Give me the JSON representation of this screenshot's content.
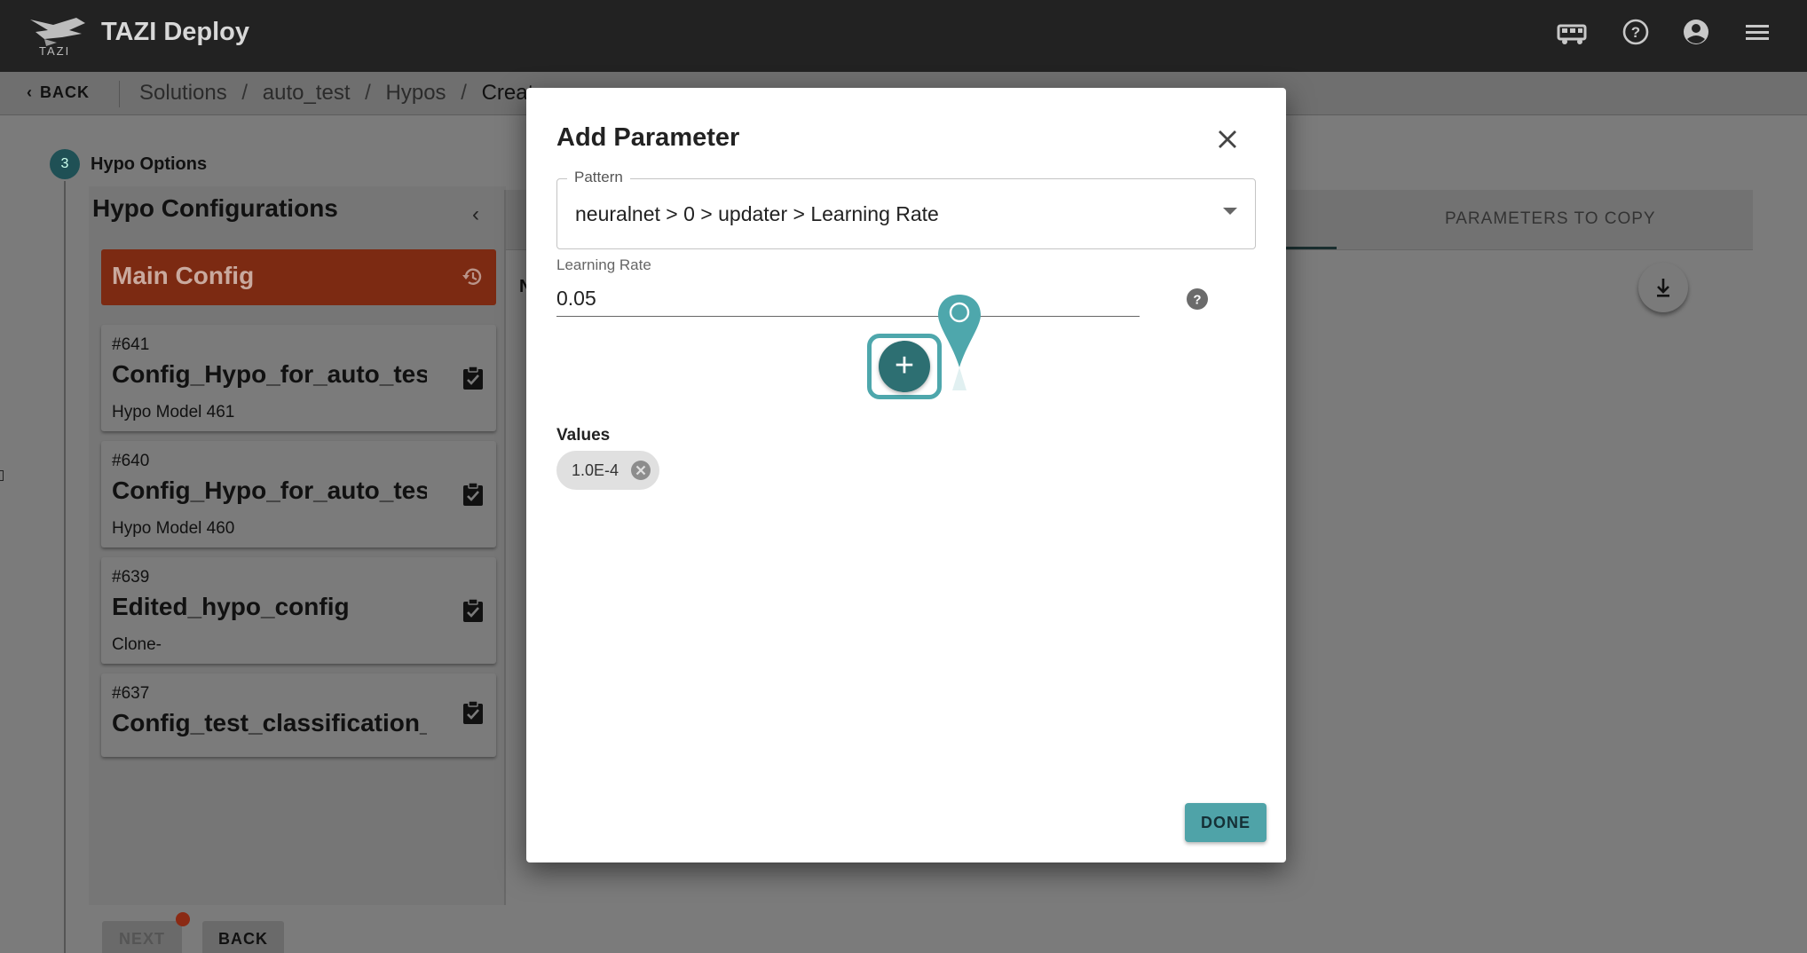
{
  "app": {
    "title": "TAZI Deploy",
    "logo_text": "TAZI"
  },
  "topbar_icons": [
    "bus-icon",
    "help-circle-icon",
    "account-circle-icon",
    "menu-icon"
  ],
  "nav": {
    "back_label": "BACK",
    "breadcrumb": [
      "Solutions",
      "auto_test",
      "Hypos",
      "Create"
    ],
    "separator": "/"
  },
  "step": {
    "number": "3",
    "label": "Hypo Options"
  },
  "sidebar": {
    "title": "Hypo Configurations",
    "main_config_label": "Main Config",
    "cards": [
      {
        "number": "#641",
        "name": "Config_Hypo_for_auto_test_",
        "subtitle": "Hypo Model 461"
      },
      {
        "number": "#640",
        "name": "Config_Hypo_for_auto_test_",
        "subtitle": "Hypo Model 460"
      },
      {
        "number": "#639",
        "name": "Edited_hypo_config",
        "subtitle": "Clone-"
      },
      {
        "number": "#637",
        "name": "Config_test_classification_",
        "subtitle": ""
      }
    ]
  },
  "main": {
    "tab_parameters_to_copy": "PARAMETERS TO COPY",
    "partial_text": "N"
  },
  "footer": {
    "next_label": "NEXT",
    "back_label": "BACK"
  },
  "modal": {
    "title": "Add Parameter",
    "pattern_label": "Pattern",
    "pattern_value": "neuralnet > 0 > updater > Learning Rate",
    "learning_rate_label": "Learning Rate",
    "learning_rate_value": "0.05",
    "values_label": "Values",
    "values": [
      "1.0E-4"
    ],
    "done_label": "DONE"
  },
  "colors": {
    "accent": "#4fa3a8",
    "accent_dark": "#2d6f72",
    "main_config": "#7c2a12"
  }
}
